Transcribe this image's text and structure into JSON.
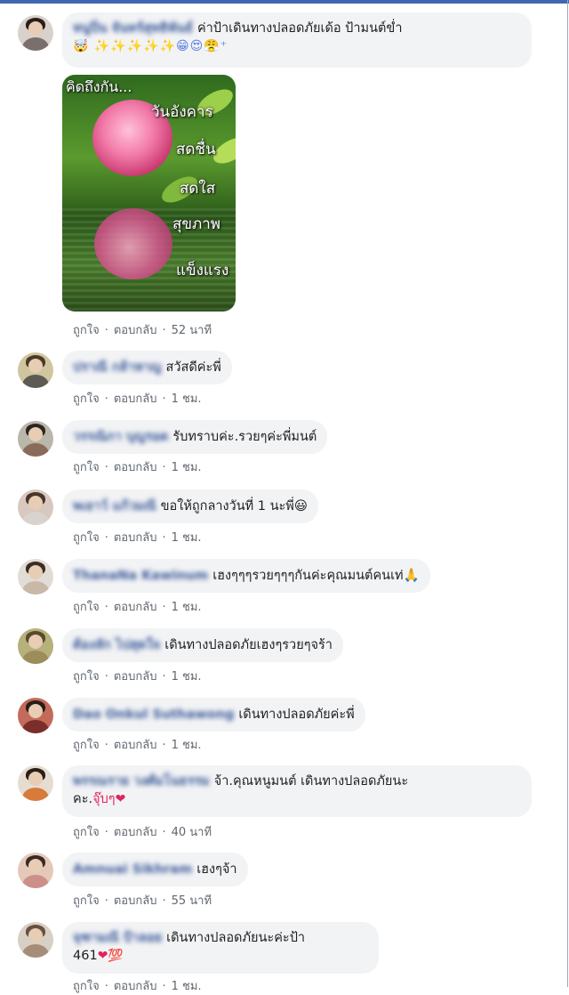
{
  "comments": [
    {
      "name": "หนูปิ่น จันทร์สุทธิพันธ์",
      "text_line1": "ค่าป้าเดินทางปลอดภัยเด้อ ป้ามนต์ข่ำ",
      "emoji_line2": "🤯 ✨✨✨✨✨😁😍😤⁺",
      "time": "52 นาที",
      "image_text": [
        "คิดถึงกัน...",
        "วันอังคาร",
        "สดชื่น",
        "สดใส",
        "สุขภาพ",
        "แข็งแรง"
      ]
    },
    {
      "name": "ปราณี กล้าหาญ",
      "text": "สวัสดีค่ะพี่",
      "time": "1 ชม."
    },
    {
      "name": "วรรณิภา บุญรอด",
      "text": "รับทราบค่ะ.รวยๆค่ะพี่มนต์",
      "time": "1 ชม."
    },
    {
      "name": "พเยาว์ แก้วมณี",
      "text": "ขอให้ถูกลางวันที่ 1 นะพี่😃",
      "time": "1 ชม."
    },
    {
      "name": "ThanaNa Kawinum",
      "text": "เฮงๆๆๆรวยๆๆๆกันค่ะคุณมนต์คนเท่🙏",
      "time": "1 ชม."
    },
    {
      "name": "ต้องลัก ไปสุดใจ",
      "text": "เดินทางปลอดภัยเฮงๆรวยๆจร้า",
      "time": "1 ชม."
    },
    {
      "name": "Dao Onkul Suthawong",
      "text": "เดินทางปลอดภัยค่ะพี่",
      "time": "1 ชม."
    },
    {
      "name": "พรรณราย วงศ์มโนธรรม",
      "text_line1": "จ้า.คุณหนูมนต์ เดินทางปลอดภัยนะ",
      "text_line2": "คะ.",
      "text_line2_red": "จุ๊บๆ",
      "text_line2_emoji": "❤",
      "time": "40 นาที"
    },
    {
      "name": "Amnuai Sikhram",
      "text": "เฮงๆจ้า",
      "time": "55 นาที"
    },
    {
      "name": "จุฑามณี ป้าลอย",
      "text_line1": "เดินทางปลอดภัยนะค่ะป้า",
      "text_line2": "461",
      "text_line2_emoji": "❤💯",
      "time": "1 ชม."
    }
  ],
  "actions": {
    "like": "ถูกใจ",
    "reply": "ตอบกลับ",
    "sep": "·"
  },
  "colors": {
    "accent": "#4267b2",
    "name": "#385898",
    "bubble": "#f2f3f5",
    "meta": "#606770"
  }
}
